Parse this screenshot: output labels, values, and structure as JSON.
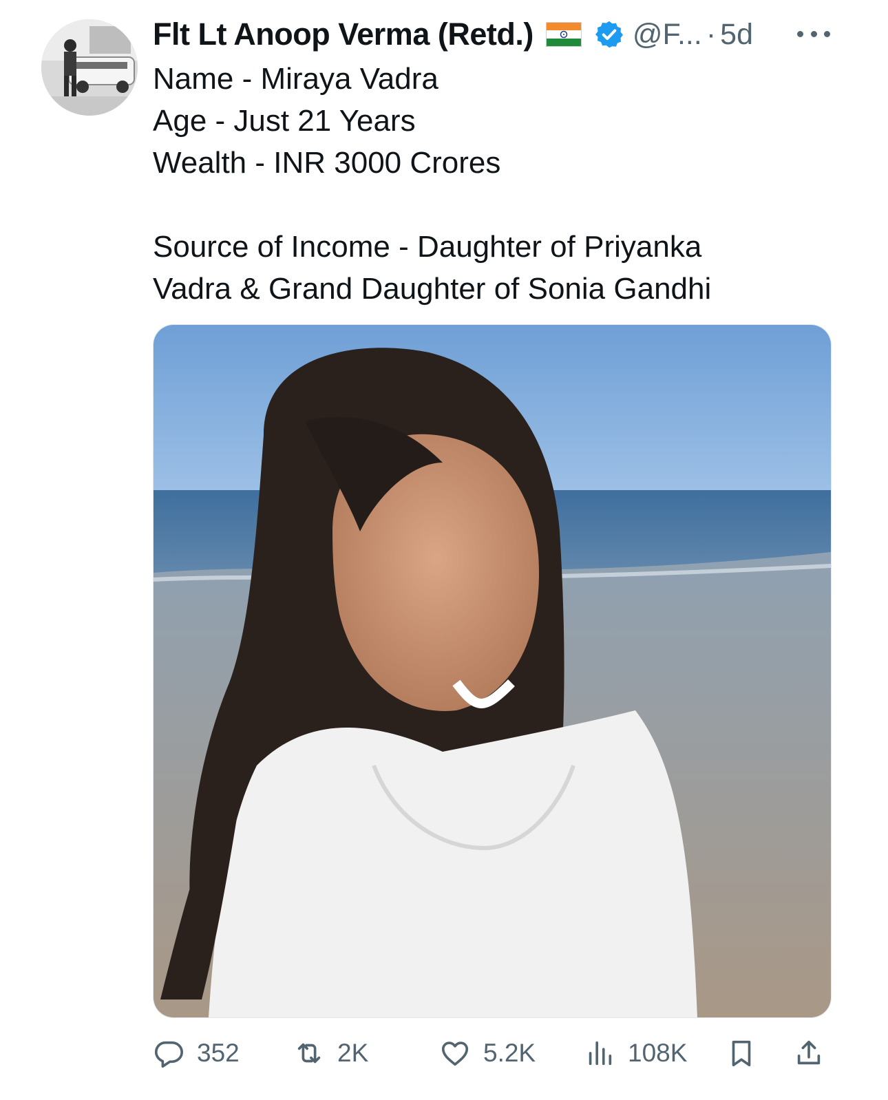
{
  "author": {
    "display_name": "Flt Lt Anoop Verma (Retd.)",
    "flag": "india-flag-icon",
    "verified": "verified-badge-icon",
    "handle": "@F...",
    "separator": "·",
    "time": "5d"
  },
  "tweet": {
    "lines": [
      "Name - Miraya Vadra",
      "Age - Just 21 Years",
      "Wealth - INR 3000 Crores"
    ],
    "source_lines": [
      "Source of Income - Daughter of Priyanka",
      "Vadra & Grand Daughter of Sonia Gandhi"
    ]
  },
  "actions": {
    "replies": "352",
    "reposts": "2K",
    "likes": "5.2K",
    "views": "108K"
  },
  "colors": {
    "text": "#0f1419",
    "secondary": "#536471",
    "verified_blue": "#1d9bf0"
  }
}
